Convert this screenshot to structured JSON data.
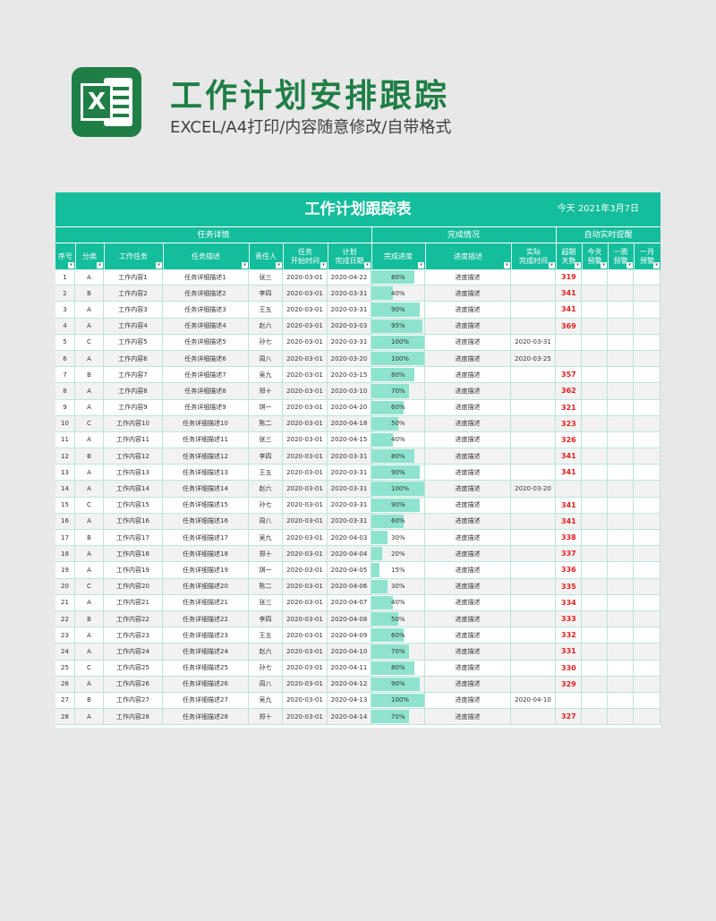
{
  "header": {
    "title": "工作计划安排跟踪",
    "subtitle": "EXCEL/A4打印/内容随意修改/自带格式",
    "logo_letter": "X"
  },
  "sheet": {
    "title": "工作计划跟踪表",
    "date": "今天  2021年3月7日",
    "groups": [
      "任务详情",
      "完成情况",
      "自动实时提醒"
    ],
    "columns": [
      "序号",
      "分类",
      "工作任务",
      "任务描述",
      "责任人",
      "任务\n开始时间",
      "计划\n完成日期",
      "完成进度",
      "进度描述",
      "实际\n完成时间",
      "超期\n天数",
      "今天\n预警",
      "一周\n预警",
      "一月\n预警"
    ],
    "rows": [
      {
        "no": "1",
        "cat": "A",
        "task": "工作内容1",
        "desc": "任务详细描述1",
        "owner": "张三",
        "start": "2020-03-01",
        "plan": "2020-04-22",
        "progress": 80,
        "progress_text": "80%",
        "pdesc": "进度描述",
        "actual": "",
        "overdue": "319"
      },
      {
        "no": "2",
        "cat": "B",
        "task": "工作内容2",
        "desc": "任务详细描述2",
        "owner": "李四",
        "start": "2020-03-01",
        "plan": "2020-03-31",
        "progress": 40,
        "progress_text": "40%",
        "pdesc": "进度描述",
        "actual": "",
        "overdue": "341"
      },
      {
        "no": "3",
        "cat": "A",
        "task": "工作内容3",
        "desc": "任务详细描述3",
        "owner": "王五",
        "start": "2020-03-01",
        "plan": "2020-03-31",
        "progress": 90,
        "progress_text": "90%",
        "pdesc": "进度描述",
        "actual": "",
        "overdue": "341"
      },
      {
        "no": "4",
        "cat": "A",
        "task": "工作内容4",
        "desc": "任务详细描述4",
        "owner": "赵六",
        "start": "2020-03-01",
        "plan": "2020-03-03",
        "progress": 95,
        "progress_text": "95%",
        "pdesc": "进度描述",
        "actual": "",
        "overdue": "369"
      },
      {
        "no": "5",
        "cat": "C",
        "task": "工作内容5",
        "desc": "任务详细描述5",
        "owner": "孙七",
        "start": "2020-03-01",
        "plan": "2020-03-31",
        "progress": 100,
        "progress_text": "100%",
        "pdesc": "进度描述",
        "actual": "2020-03-31",
        "overdue": ""
      },
      {
        "no": "6",
        "cat": "A",
        "task": "工作内容6",
        "desc": "任务详细描述6",
        "owner": "周八",
        "start": "2020-03-01",
        "plan": "2020-03-20",
        "progress": 100,
        "progress_text": "100%",
        "pdesc": "进度描述",
        "actual": "2020-03-25",
        "overdue": ""
      },
      {
        "no": "7",
        "cat": "B",
        "task": "工作内容7",
        "desc": "任务详细描述7",
        "owner": "吴九",
        "start": "2020-03-01",
        "plan": "2020-03-15",
        "progress": 80,
        "progress_text": "80%",
        "pdesc": "进度描述",
        "actual": "",
        "overdue": "357"
      },
      {
        "no": "8",
        "cat": "A",
        "task": "工作内容8",
        "desc": "任务详细描述8",
        "owner": "郑十",
        "start": "2020-03-01",
        "plan": "2020-03-10",
        "progress": 70,
        "progress_text": "70%",
        "pdesc": "进度描述",
        "actual": "",
        "overdue": "362"
      },
      {
        "no": "9",
        "cat": "A",
        "task": "工作内容9",
        "desc": "任务详细描述9",
        "owner": "琪一",
        "start": "2020-03-01",
        "plan": "2020-04-20",
        "progress": 60,
        "progress_text": "60%",
        "pdesc": "进度描述",
        "actual": "",
        "overdue": "321"
      },
      {
        "no": "10",
        "cat": "C",
        "task": "工作内容10",
        "desc": "任务详细描述10",
        "owner": "陈二",
        "start": "2020-03-01",
        "plan": "2020-04-18",
        "progress": 50,
        "progress_text": "50%",
        "pdesc": "进度描述",
        "actual": "",
        "overdue": "323"
      },
      {
        "no": "11",
        "cat": "A",
        "task": "工作内容11",
        "desc": "任务详细描述11",
        "owner": "张三",
        "start": "2020-03-01",
        "plan": "2020-04-15",
        "progress": 40,
        "progress_text": "40%",
        "pdesc": "进度描述",
        "actual": "",
        "overdue": "326"
      },
      {
        "no": "12",
        "cat": "B",
        "task": "工作内容12",
        "desc": "任务详细描述12",
        "owner": "李四",
        "start": "2020-03-01",
        "plan": "2020-03-31",
        "progress": 80,
        "progress_text": "80%",
        "pdesc": "进度描述",
        "actual": "",
        "overdue": "341"
      },
      {
        "no": "13",
        "cat": "A",
        "task": "工作内容13",
        "desc": "任务详细描述13",
        "owner": "王五",
        "start": "2020-03-01",
        "plan": "2020-03-31",
        "progress": 90,
        "progress_text": "90%",
        "pdesc": "进度描述",
        "actual": "",
        "overdue": "341"
      },
      {
        "no": "14",
        "cat": "A",
        "task": "工作内容14",
        "desc": "任务详细描述14",
        "owner": "赵六",
        "start": "2020-03-01",
        "plan": "2020-03-31",
        "progress": 100,
        "progress_text": "100%",
        "pdesc": "进度描述",
        "actual": "2020-03-20",
        "overdue": ""
      },
      {
        "no": "15",
        "cat": "C",
        "task": "工作内容15",
        "desc": "任务详细描述15",
        "owner": "孙七",
        "start": "2020-03-01",
        "plan": "2020-03-31",
        "progress": 90,
        "progress_text": "90%",
        "pdesc": "进度描述",
        "actual": "",
        "overdue": "341"
      },
      {
        "no": "16",
        "cat": "A",
        "task": "工作内容16",
        "desc": "任务详细描述16",
        "owner": "周八",
        "start": "2020-03-01",
        "plan": "2020-03-31",
        "progress": 60,
        "progress_text": "60%",
        "pdesc": "进度描述",
        "actual": "",
        "overdue": "341"
      },
      {
        "no": "17",
        "cat": "B",
        "task": "工作内容17",
        "desc": "任务详细描述17",
        "owner": "吴九",
        "start": "2020-03-01",
        "plan": "2020-04-03",
        "progress": 30,
        "progress_text": "30%",
        "pdesc": "进度描述",
        "actual": "",
        "overdue": "338"
      },
      {
        "no": "18",
        "cat": "A",
        "task": "工作内容18",
        "desc": "任务详细描述18",
        "owner": "郑十",
        "start": "2020-03-01",
        "plan": "2020-04-04",
        "progress": 20,
        "progress_text": "20%",
        "pdesc": "进度描述",
        "actual": "",
        "overdue": "337"
      },
      {
        "no": "19",
        "cat": "A",
        "task": "工作内容19",
        "desc": "任务详细描述19",
        "owner": "琪一",
        "start": "2020-03-01",
        "plan": "2020-04-05",
        "progress": 15,
        "progress_text": "15%",
        "pdesc": "进度描述",
        "actual": "",
        "overdue": "336"
      },
      {
        "no": "20",
        "cat": "C",
        "task": "工作内容20",
        "desc": "任务详细描述20",
        "owner": "陈二",
        "start": "2020-03-01",
        "plan": "2020-04-06",
        "progress": 30,
        "progress_text": "30%",
        "pdesc": "进度描述",
        "actual": "",
        "overdue": "335"
      },
      {
        "no": "21",
        "cat": "A",
        "task": "工作内容21",
        "desc": "任务详细描述21",
        "owner": "张三",
        "start": "2020-03-01",
        "plan": "2020-04-07",
        "progress": 40,
        "progress_text": "40%",
        "pdesc": "进度描述",
        "actual": "",
        "overdue": "334"
      },
      {
        "no": "22",
        "cat": "B",
        "task": "工作内容22",
        "desc": "任务详细描述22",
        "owner": "李四",
        "start": "2020-03-01",
        "plan": "2020-04-08",
        "progress": 50,
        "progress_text": "50%",
        "pdesc": "进度描述",
        "actual": "",
        "overdue": "333"
      },
      {
        "no": "23",
        "cat": "A",
        "task": "工作内容23",
        "desc": "任务详细描述23",
        "owner": "王五",
        "start": "2020-03-01",
        "plan": "2020-04-09",
        "progress": 60,
        "progress_text": "60%",
        "pdesc": "进度描述",
        "actual": "",
        "overdue": "332"
      },
      {
        "no": "24",
        "cat": "A",
        "task": "工作内容24",
        "desc": "任务详细描述24",
        "owner": "赵六",
        "start": "2020-03-01",
        "plan": "2020-04-10",
        "progress": 70,
        "progress_text": "70%",
        "pdesc": "进度描述",
        "actual": "",
        "overdue": "331"
      },
      {
        "no": "25",
        "cat": "C",
        "task": "工作内容25",
        "desc": "任务详细描述25",
        "owner": "孙七",
        "start": "2020-03-01",
        "plan": "2020-04-11",
        "progress": 80,
        "progress_text": "80%",
        "pdesc": "进度描述",
        "actual": "",
        "overdue": "330"
      },
      {
        "no": "26",
        "cat": "A",
        "task": "工作内容26",
        "desc": "任务详细描述26",
        "owner": "周八",
        "start": "2020-03-01",
        "plan": "2020-04-12",
        "progress": 90,
        "progress_text": "90%",
        "pdesc": "进度描述",
        "actual": "",
        "overdue": "329"
      },
      {
        "no": "27",
        "cat": "B",
        "task": "工作内容27",
        "desc": "任务详细描述27",
        "owner": "吴九",
        "start": "2020-03-01",
        "plan": "2020-04-13",
        "progress": 100,
        "progress_text": "100%",
        "pdesc": "进度描述",
        "actual": "2020-04-10",
        "overdue": ""
      },
      {
        "no": "28",
        "cat": "A",
        "task": "工作内容28",
        "desc": "任务详细描述28",
        "owner": "郑十",
        "start": "2020-03-01",
        "plan": "2020-04-14",
        "progress": 70,
        "progress_text": "70%",
        "pdesc": "进度描述",
        "actual": "",
        "overdue": "327"
      }
    ]
  },
  "colors": {
    "brand_green": "#1f7e45",
    "teal": "#14bd9b",
    "progress_fill": "#8ee3cf",
    "overdue_red": "#e02020"
  },
  "icons": {
    "logo": "excel-icon",
    "filter": "dropdown-arrow-icon"
  }
}
